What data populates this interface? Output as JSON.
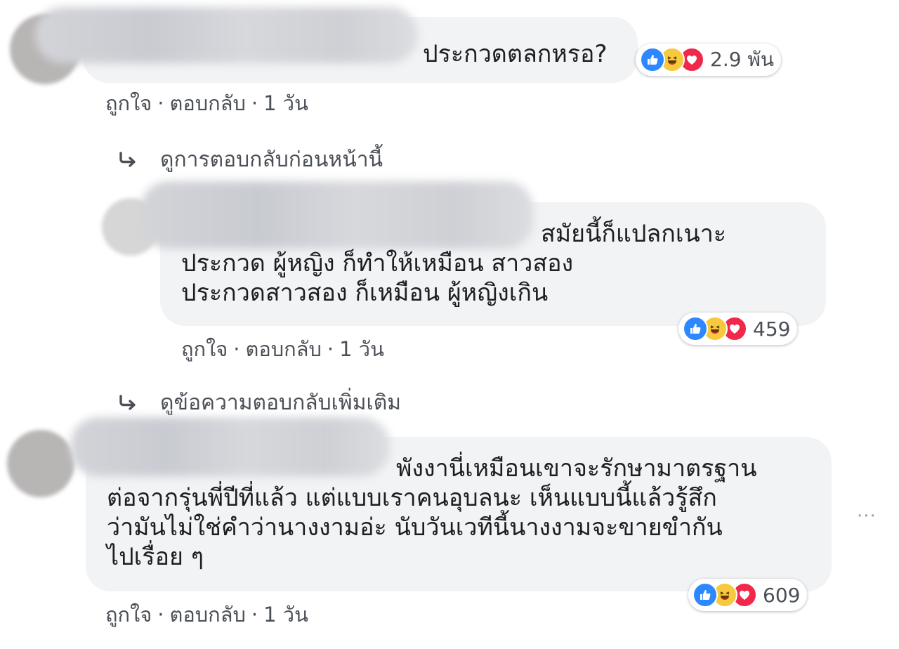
{
  "comments": [
    {
      "text": "ประกวดตลกหรอ?",
      "reactions": {
        "icons": [
          "like-icon",
          "haha-icon",
          "love-icon"
        ],
        "count": "2.9 พัน"
      },
      "actions": {
        "like": "ถูกใจ",
        "reply": "ตอบกลับ",
        "time": "1 วัน",
        "separator": "·"
      }
    },
    {
      "text": "สมัยนี้ก็แปลกเนาะ\nประกวด ผู้หญิง ก็ทำให้เหมือน สาวสอง\nประกวดสาวสอง ก็เหมือน ผู้หญิงเกิน",
      "reactions": {
        "icons": [
          "like-icon",
          "haha-icon",
          "love-icon"
        ],
        "count": "459"
      },
      "actions": {
        "like": "ถูกใจ",
        "reply": "ตอบกลับ",
        "time": "1 วัน",
        "separator": "·"
      }
    },
    {
      "text": "พังงานี่เหมือนเขาจะรักษามาตรฐาน\nต่อจากรุ่นพี่ปีที่แล้ว แต่แบบเราคนอุบลนะ เห็นแบบนี้แล้วรู้สึก\nว่ามันไม่ใช่คำว่านางงามอ่ะ นับวันเวทีนี้นางงามจะขายขำกัน\nไปเรื่อย ๆ",
      "reactions": {
        "icons": [
          "like-icon",
          "haha-icon",
          "love-icon"
        ],
        "count": "609"
      },
      "actions": {
        "like": "ถูกใจ",
        "reply": "ตอบกลับ",
        "time": "1 วัน",
        "separator": "·"
      }
    }
  ],
  "links": {
    "previous_replies": "ดูการตอบกลับก่อนหน้านี้",
    "more_replies": "ดูข้อความตอบกลับเพิ่มเติม"
  },
  "more_options": "···",
  "colors": {
    "bubble": "#f2f3f5",
    "like": "#2d88ff",
    "haha": "#f7c93e",
    "love": "#f0284a",
    "meta_text": "#4b4f56"
  }
}
